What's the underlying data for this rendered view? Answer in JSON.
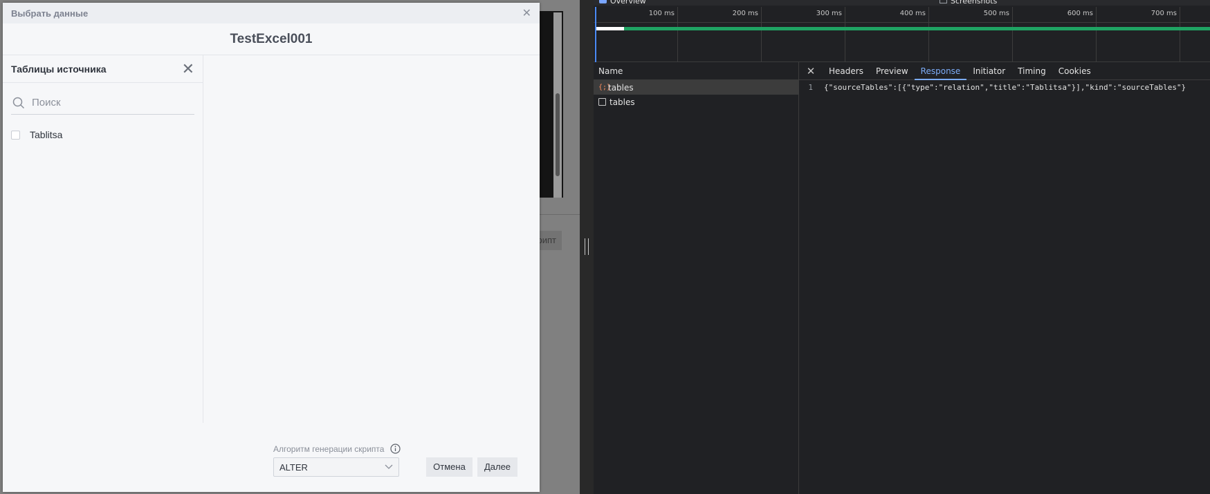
{
  "modal": {
    "header_title": "Выбрать данные",
    "title": "TestExcel001",
    "sidebar": {
      "title": "Таблицы источника",
      "search_placeholder": "Поиск",
      "tables": [
        {
          "label": "Tablitsa",
          "checked": false
        }
      ]
    },
    "footer": {
      "algo_label": "Алгоритм генерации скрипта",
      "algo_value": "ALTER",
      "cancel_label": "Отмена",
      "next_label": "Далее"
    }
  },
  "background_app": {
    "button_fragment": "рипт"
  },
  "devtools": {
    "overview_label": "Overview",
    "screenshots_label": "Screenshots",
    "timeline_ticks": [
      "100 ms",
      "200 ms",
      "300 ms",
      "400 ms",
      "500 ms",
      "600 ms",
      "700 ms"
    ],
    "names_header": "Name",
    "requests": [
      {
        "name": "tables",
        "type": "json",
        "selected": true
      },
      {
        "name": "tables",
        "type": "doc",
        "selected": false
      }
    ],
    "tabs": [
      "Headers",
      "Preview",
      "Response",
      "Initiator",
      "Timing",
      "Cookies"
    ],
    "active_tab": "Response",
    "response": {
      "line_number": "1",
      "text": "{\"sourceTables\":[{\"type\":\"relation\",\"title\":\"Tablitsa\"}],\"kind\":\"sourceTables\"}"
    }
  }
}
